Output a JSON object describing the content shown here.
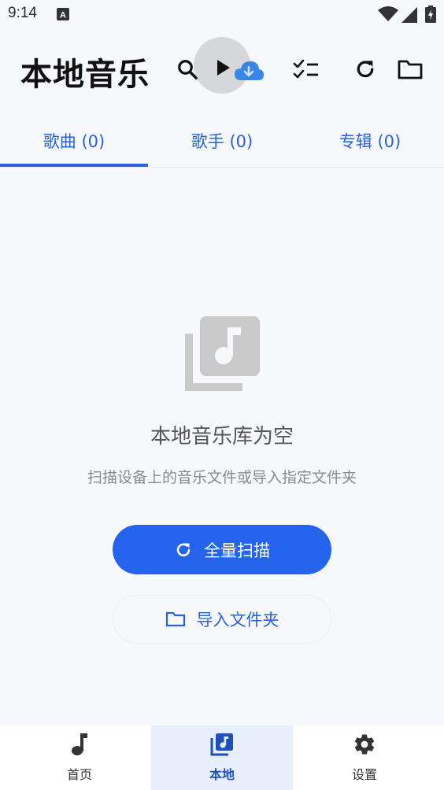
{
  "status_bar": {
    "time": "9:14"
  },
  "header": {
    "title": "本地音乐"
  },
  "icons": {
    "search": "search-icon",
    "play": "play-icon",
    "cloud_download": "cloud-download-icon",
    "checklist": "checklist-icon",
    "refresh": "refresh-icon",
    "folder": "folder-icon"
  },
  "tabs": [
    {
      "label": "歌曲 (0)",
      "selected": true
    },
    {
      "label": "歌手 (0)",
      "selected": false
    },
    {
      "label": "专辑 (0)",
      "selected": false
    }
  ],
  "empty_state": {
    "title": "本地音乐库为空",
    "subtitle": "扫描设备上的音乐文件或导入指定文件夹",
    "icon": "music-library-icon"
  },
  "buttons": {
    "scan_all": "全量扫描",
    "import_folder": "导入文件夹"
  },
  "bottom_nav": [
    {
      "label": "首页",
      "icon": "music-note-icon",
      "active": false
    },
    {
      "label": "本地",
      "icon": "library-music-icon",
      "active": true
    },
    {
      "label": "设置",
      "icon": "gear-icon",
      "active": false
    }
  ],
  "colors": {
    "accent": "#2463eb",
    "tab_text": "#2a62d9",
    "background": "#f7f8fb",
    "nav_active_bg": "#e8effc"
  }
}
